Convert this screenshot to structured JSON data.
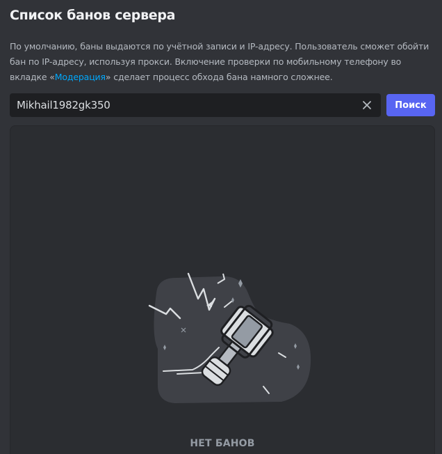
{
  "header": {
    "title": "Список банов сервера"
  },
  "description": {
    "text_before_link": "По умолчанию, баны выдаются по учётной записи и IP-адресу. Пользователь сможет обойти бан по IP-адресу, используя прокси. Включение проверки по мобильному телефону во вкладке «",
    "link_text": "Модерация",
    "text_after_link": "» сделает процесс обхода бана намного сложнее."
  },
  "search": {
    "value": "Mikhail1982gk350",
    "placeholder": "",
    "clear_icon": "close-icon",
    "button_label": "Поиск"
  },
  "empty_state": {
    "illustration": "ban-hammer-illustration",
    "label": "НЕТ БАНОВ"
  },
  "colors": {
    "background": "#313338",
    "panel": "#2b2d31",
    "input": "#1e1f22",
    "accent": "#5865f2",
    "link": "#00a8fc"
  }
}
